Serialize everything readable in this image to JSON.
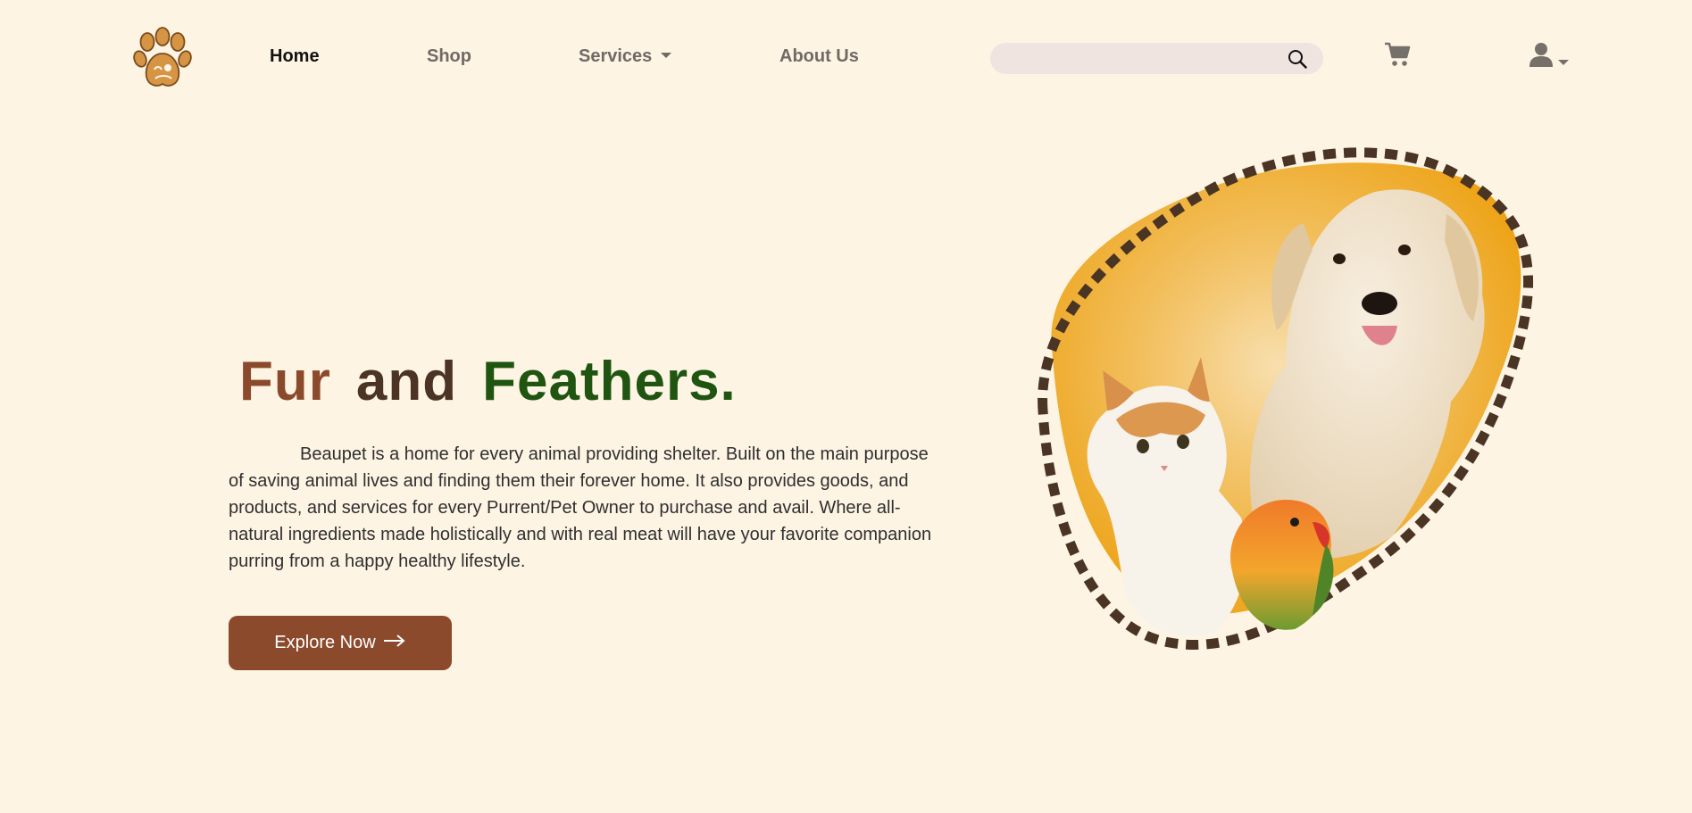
{
  "nav": {
    "logo_icon": "paw-pet-logo",
    "links": [
      {
        "label": "Home",
        "active": true
      },
      {
        "label": "Shop",
        "active": false
      },
      {
        "label": "Services",
        "active": false,
        "has_dropdown": true
      },
      {
        "label": "About Us",
        "active": false
      }
    ],
    "search": {
      "placeholder": "",
      "value": "",
      "icon": "search-icon"
    },
    "cart_icon": "cart-icon",
    "user_icon": "user-icon"
  },
  "hero": {
    "title_words": [
      "Fur",
      "and",
      "Feathers."
    ],
    "description": "Beaupet is a home for every animal providing shelter. Built on the main purpose of saving animal lives and finding them their forever home. It also provides goods, and products, and services for every Purrent/Pet Owner to purchase and avail. Where all-natural ingredients made holistically and with real meat will have your favorite companion purring from a happy healthy lifestyle.",
    "cta_label": "Explore Now",
    "cta_icon": "arrow-right-icon",
    "image": "dog-cat-bird-illustration"
  },
  "colors": {
    "background": "#fef4e4",
    "accent_brown": "#8b4a2b",
    "dark_brown": "#4b3424",
    "green": "#1f5510",
    "search_bg": "#f0e4e1",
    "blob_orange": "#eea413"
  }
}
